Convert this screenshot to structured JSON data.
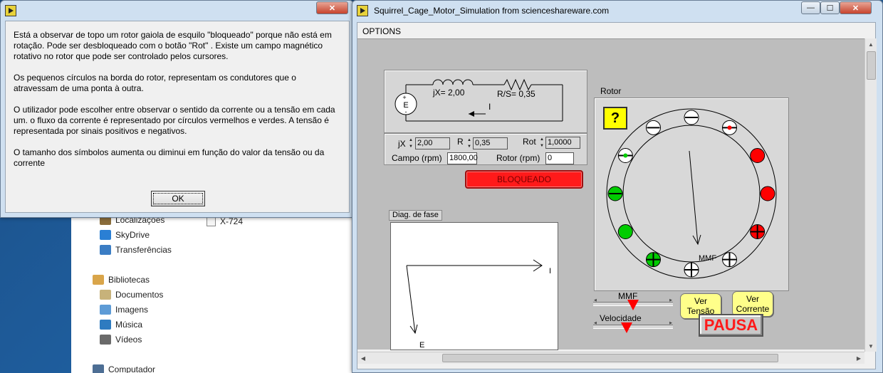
{
  "explorer": {
    "nav_items": [
      {
        "label": "Localizações",
        "icon": "location-folder-icon",
        "color": "#8a6d3b"
      },
      {
        "label": "SkyDrive",
        "icon": "skydrive-cloud-icon",
        "color": "#2a7fd4"
      },
      {
        "label": "Transferências",
        "icon": "downloads-folder-icon",
        "color": "#3b7dc4"
      },
      {
        "label": "Bibliotecas",
        "icon": "libraries-icon",
        "color": "#d9a54a"
      },
      {
        "label": "Documentos",
        "icon": "documents-icon",
        "color": "#c7b27a"
      },
      {
        "label": "Imagens",
        "icon": "pictures-icon",
        "color": "#5d9bd6"
      },
      {
        "label": "Música",
        "icon": "music-icon",
        "color": "#2e7bc0"
      },
      {
        "label": "Vídeos",
        "icon": "videos-icon",
        "color": "#6a6a6a"
      },
      {
        "label": "Computador",
        "icon": "computer-icon",
        "color": "#4d6e94"
      }
    ],
    "file_label": "X-724"
  },
  "dialog": {
    "paragraphs": [
      "Está a observar de topo um rotor gaiola de esquilo \"bloqueado\" porque não está em rotação. Pode ser desbloqueado com o botão \"Rot\" . Existe um campo magnético rotativo no rotor que pode ser controlado pelos cursores.",
      "Os pequenos círculos na borda do rotor, representam os condutores que o atravessam de uma ponta à outra.",
      "O utilizador pode escolher entre observar o sentido da corrente ou a tensão em cada um. o fluxo da corrente é representado por círculos vermelhos e verdes. A tensão é representada por sinais positivos e negativos.",
      "O tamanho dos símbolos aumenta ou diminui em função do valor da tensão ou da corrente"
    ],
    "ok_label": "OK",
    "close_glyph": "✕"
  },
  "main": {
    "title": "Squirrel_Cage_Motor_Simulation from scienceshareware.com",
    "menu": "OPTIONS",
    "controls": {
      "minimize": "—",
      "maximize": "☐",
      "close": "✕"
    },
    "circuit": {
      "jx_label": "jX= 2,00",
      "rs_label": "R/S= 0,35",
      "current_label": "I",
      "source_label": "E",
      "source_plus": "+",
      "source_minus": "-"
    },
    "params": {
      "jx_label": "jX",
      "jx_value": "2,00",
      "r_label": "R",
      "r_value": "0,35",
      "rot_label": "Rot",
      "rot_value": "1,0000",
      "campo_label": "Campo  (rpm)",
      "campo_value": "1800,00",
      "rotor_label": "Rotor  (rpm)",
      "rotor_value": "0"
    },
    "status": "BLOQUEADO",
    "phase_diagram": {
      "tab_label": "Diag. de fase",
      "i_label": "I",
      "e_label": "E"
    },
    "rotor": {
      "section_label": "Rotor",
      "help_label": "?",
      "mmf_vector_label": "MMF",
      "conductors": [
        {
          "angle": -90,
          "type": "minus-white"
        },
        {
          "angle": -60,
          "type": "dot-white-red"
        },
        {
          "angle": -30,
          "type": "red"
        },
        {
          "angle": 0,
          "type": "red"
        },
        {
          "angle": 30,
          "type": "plus-red"
        },
        {
          "angle": 60,
          "type": "plus-white"
        },
        {
          "angle": 90,
          "type": "plus-white"
        },
        {
          "angle": 120,
          "type": "plus-green"
        },
        {
          "angle": 150,
          "type": "green"
        },
        {
          "angle": 180,
          "type": "minus-green"
        },
        {
          "angle": 210,
          "type": "dot-white-green"
        },
        {
          "angle": 240,
          "type": "minus-white"
        }
      ]
    },
    "sliders": {
      "mmf_label": "MMF",
      "mmf_position": 0.5,
      "velocidade_label": "Velocidade",
      "velocidade_position": 0.42
    },
    "buttons": {
      "ver_tensao": "Ver Tensão",
      "ver_corrente": "Ver Corrente",
      "pausa": "PAUSA"
    },
    "colors": {
      "red": "#ff0000",
      "green": "#00cc00",
      "yellow": "#ffff00"
    }
  }
}
